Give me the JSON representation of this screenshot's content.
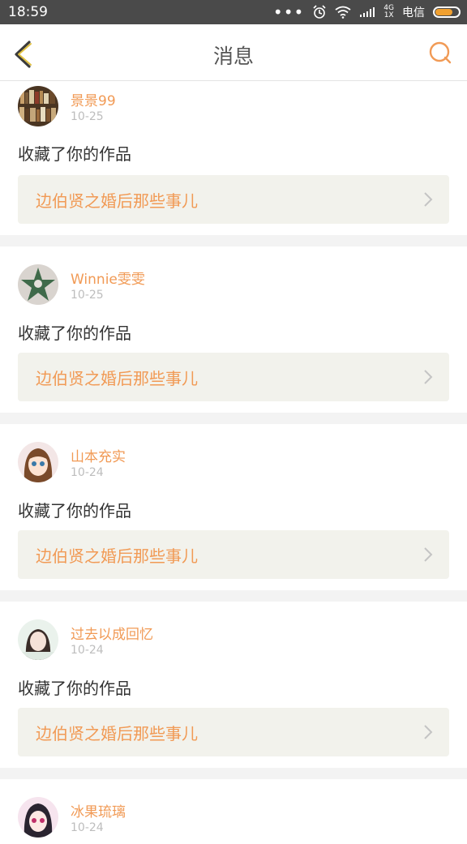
{
  "status_bar": {
    "time": "18:59",
    "network": "4G\n1X",
    "carrier": "电信",
    "battery_level": 0.7
  },
  "header": {
    "title": "消息"
  },
  "messages": [
    {
      "user": "景景99",
      "date": "10-25",
      "action": "收藏了你的作品",
      "work_title": "边伯贤之婚后那些事儿",
      "avatar_icon": "avatar-bookshelf"
    },
    {
      "user": "Winnie雯雯",
      "date": "10-25",
      "action": "收藏了你的作品",
      "work_title": "边伯贤之婚后那些事儿",
      "avatar_icon": "avatar-star"
    },
    {
      "user": "山本充实",
      "date": "10-24",
      "action": "收藏了你的作品",
      "work_title": "边伯贤之婚后那些事儿",
      "avatar_icon": "avatar-anime-girl"
    },
    {
      "user": "过去以成回忆",
      "date": "10-24",
      "action": "收藏了你的作品",
      "work_title": "边伯贤之婚后那些事儿",
      "avatar_icon": "avatar-photo-girl"
    },
    {
      "user": "冰果琉璃",
      "date": "10-24",
      "avatar_icon": "avatar-anime"
    }
  ],
  "colors": {
    "accent": "#f19a55",
    "status_bar_bg": "#4a4a4a",
    "work_box_bg": "#f2f2ec"
  }
}
